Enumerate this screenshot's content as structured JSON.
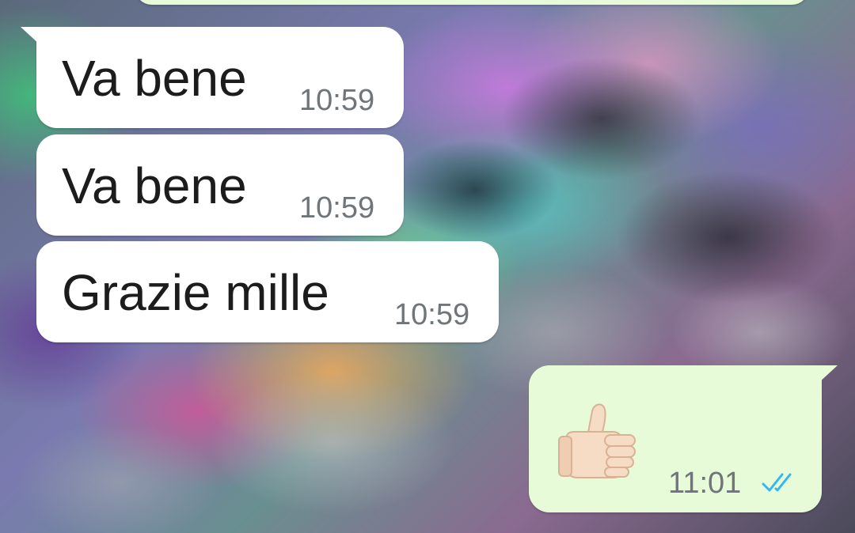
{
  "conversation": {
    "messages": [
      {
        "direction": "incoming",
        "text": "Va bene",
        "time": "10:59"
      },
      {
        "direction": "incoming",
        "text": "Va bene",
        "time": "10:59"
      },
      {
        "direction": "incoming",
        "text": "Grazie mille",
        "time": "10:59"
      },
      {
        "direction": "outgoing",
        "emoji": "thumbs-up",
        "time": "11:01",
        "status": "read"
      }
    ]
  },
  "colors": {
    "incoming_bubble": "#ffffff",
    "outgoing_bubble": "#e8fbd8",
    "read_ticks": "#34b7f1",
    "timestamp": "#6f7579"
  }
}
